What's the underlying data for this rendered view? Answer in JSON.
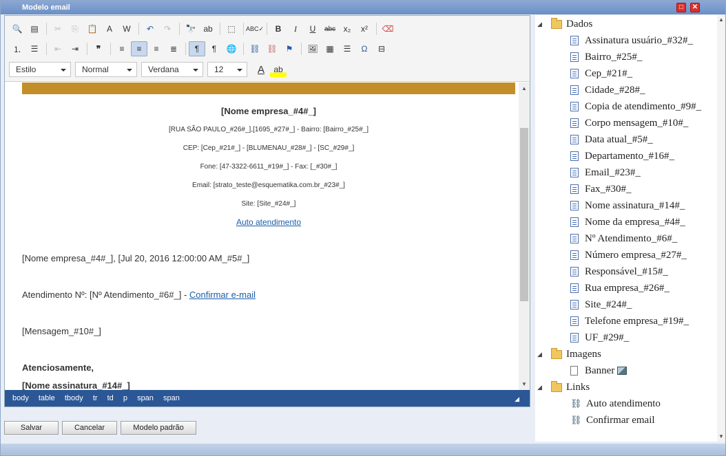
{
  "window": {
    "title": "Modelo email"
  },
  "toolbar": {
    "style_combo": "Estilo",
    "format_combo": "Normal",
    "font_combo": "Verdana",
    "size_combo": "12"
  },
  "document": {
    "company": "[Nome empresa_#4#_]",
    "address": "[RUA SÃO PAULO_#26#_],[1695_#27#_] - Bairro: [Bairro_#25#_]",
    "cep": "CEP: [Cep_#21#_] - [BLUMENAU_#28#_] - [SC_#29#_]",
    "phone": "Fone: [47-3322-6611_#19#_] - Fax: [_#30#_]",
    "email": "Email: [strato_teste@esquematika.com.br_#23#_]",
    "site": "Site: [Site_#24#_]",
    "auto_link": "Auto atendimento",
    "greeting": "[Nome empresa_#4#_], [Jul 20, 2016 12:00:00 AM_#5#_]",
    "atendimento_prefix": "Atendimento Nº: [Nº Atendimento_#6#_] - ",
    "confirm_link": "Confirmar e-mail",
    "message": "[Mensagem_#10#_]",
    "closing": "Atenciosamente,",
    "signature": "[Nome assinatura_#14#_]"
  },
  "statusbar": [
    "body",
    "table",
    "tbody",
    "tr",
    "td",
    "p",
    "span",
    "span"
  ],
  "buttons": {
    "save": "Salvar",
    "cancel": "Cancelar",
    "default": "Modelo padrão"
  },
  "tree": {
    "dados_label": "Dados",
    "dados_items": [
      "Assinatura usuário_#32#_",
      "Bairro_#25#_",
      "Cep_#21#_",
      "Cidade_#28#_",
      "Copia de atendimento_#9#_",
      "Corpo mensagem_#10#_",
      "Data atual_#5#_",
      "Departamento_#16#_",
      "Email_#23#_",
      "Fax_#30#_",
      "Nome assinatura_#14#_",
      "Nome da empresa_#4#_",
      "Nº Atendimento_#6#_",
      "Número empresa_#27#_",
      "Responsável_#15#_",
      "Rua empresa_#26#_",
      "Site_#24#_",
      "Telefone empresa_#19#_",
      "UF_#29#_"
    ],
    "imagens_label": "Imagens",
    "imagens_items": [
      "Banner"
    ],
    "links_label": "Links",
    "links_items": [
      "Auto atendimento",
      "Confirmar email"
    ]
  }
}
